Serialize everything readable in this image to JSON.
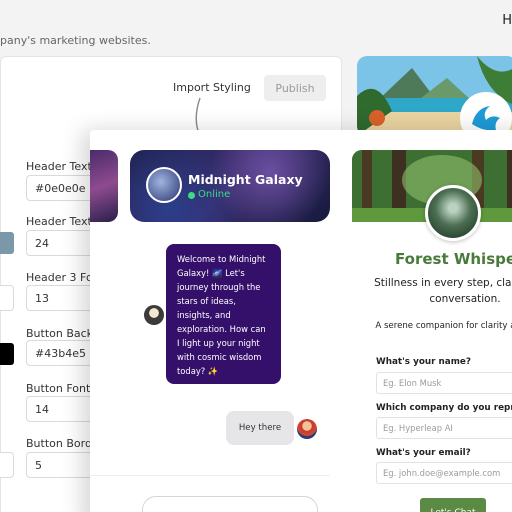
{
  "header": {
    "description_fragment": "pany's marketing websites.",
    "corner_text": "H"
  },
  "toolbar": {
    "import_label": "Import Styling",
    "publish_label": "Publish"
  },
  "settings": {
    "fields": [
      {
        "label": "Header Text C",
        "value": "#0e0e0e"
      },
      {
        "label": "Header Text S",
        "value": "24"
      },
      {
        "label": "Header 3 Fon",
        "value": "13"
      },
      {
        "label": "Button Backg",
        "value": "#43b4e5"
      },
      {
        "label": "Button Font S",
        "value": "14"
      },
      {
        "label": "Button Borde",
        "value": "5"
      }
    ],
    "swatch_colors": [
      "#7a98a8",
      "#000000"
    ]
  },
  "galaxy": {
    "title": "Midnight Galaxy",
    "status": "Online",
    "bot_message": "Welcome to Midnight Galaxy! 🌌 Let's journey through the stars of ideas, insights, and exploration. How can I light up your night with cosmic wisdom today? ✨",
    "user_message": "Hey there",
    "bubble_color": "#35106b"
  },
  "forest": {
    "title": "Forest Whispers",
    "tagline": "Stillness in every step, clarit every conversation.",
    "description": "A serene companion for clarity a support!",
    "form": [
      {
        "label": "What's your name?",
        "placeholder": "Eg. Elon Musk"
      },
      {
        "label": "Which company do you represent",
        "placeholder": "Eg. Hyperleap AI"
      },
      {
        "label": "What's your email?",
        "placeholder": "Eg. john.doe@example.com"
      }
    ],
    "button_label": "Let's Chat",
    "accent_color": "#5b8a44"
  }
}
